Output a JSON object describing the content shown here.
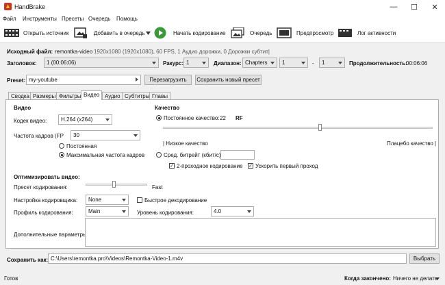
{
  "window": {
    "title": "HandBrake",
    "minimize": "—",
    "maximize": "☐",
    "close": "✕"
  },
  "menu": [
    "Файл",
    "Инструменты",
    "Пресеты",
    "Очередь",
    "Помощь"
  ],
  "toolbar": {
    "open_source": "Открыть источник",
    "add_queue": "Добавить в очередь",
    "start": "Начать кодирование",
    "queue": "Очередь",
    "preview": "Предпросмотр",
    "activity": "Лог активности"
  },
  "source": {
    "label": "Исходный файл:",
    "name": "remontka-video",
    "info": "1920x1080 (1920x1080), 60 FPS, 1 Аудио дорожки, 0 Дорожки субтит|"
  },
  "title_row": {
    "title_label": "Заголовок:",
    "title_value": "1 (00:06:06)",
    "angle_label": "Ракурс:",
    "angle_value": "1",
    "range_label": "Диапазон:",
    "range_type": "Chapters",
    "range_from": "1",
    "range_dash": "-",
    "range_to": "1",
    "duration_label": "Продолжительность:",
    "duration_value": "00:06:06"
  },
  "preset": {
    "label": "Preset:",
    "value": "my-youtube",
    "reload": "Перезагрузить",
    "save_new": "Сохранить новый пресет"
  },
  "tabs": [
    "Сводка",
    "Размеры",
    "Фильтры",
    "Видео",
    "Аудио",
    "Субтитры",
    "Главы"
  ],
  "video": {
    "section": "Видео",
    "codec_label": "Кодек видео:",
    "codec_value": "H.264 (x264)",
    "fps_label": "Частота кадров (FP",
    "fps_value": "30",
    "constant": "Постоянная",
    "peak": "Максимальная частота кадров"
  },
  "quality": {
    "section": "Качество",
    "constant_label": "Постоянное качество:",
    "constant_value": "22",
    "rf": "RF",
    "slider_fraction": 0.58,
    "low": "| Низкое качество",
    "high": "Плацебо качество |",
    "avg_label": "Сред. битрейт (кбит/с):",
    "avg_value": "",
    "two_pass": "2-проходное кодирование",
    "turbo": "Ускорить первый проход",
    "check_mark": "✓"
  },
  "optimise": {
    "section": "Оптимизировать видео:",
    "preset_label": "Пресет кодирования:",
    "preset_fraction": 0.45,
    "preset_value": "Fast",
    "tune_label": "Настройка кодировщика:",
    "tune_value": "None",
    "fast_decode": "Быстрое декодирование",
    "profile_label": "Профиль кодирования:",
    "profile_value": "Main",
    "level_label": "Уровень кодирования:",
    "level_value": "4.0",
    "extra_label": "Дополнительные параметры:",
    "extra_value": ""
  },
  "save": {
    "label": "Сохранить как:",
    "path": "C:\\Users\\remontka.pro\\Videos\\Remontka-Video-1.m4v",
    "browse": "Выбрать"
  },
  "status": {
    "ready": "Готов",
    "when_done_label": "Когда закончено:",
    "when_done_value": "Ничего не делать"
  },
  "colors": {
    "start_green": "#3a9a3a",
    "accent": "#1a6fc9"
  }
}
